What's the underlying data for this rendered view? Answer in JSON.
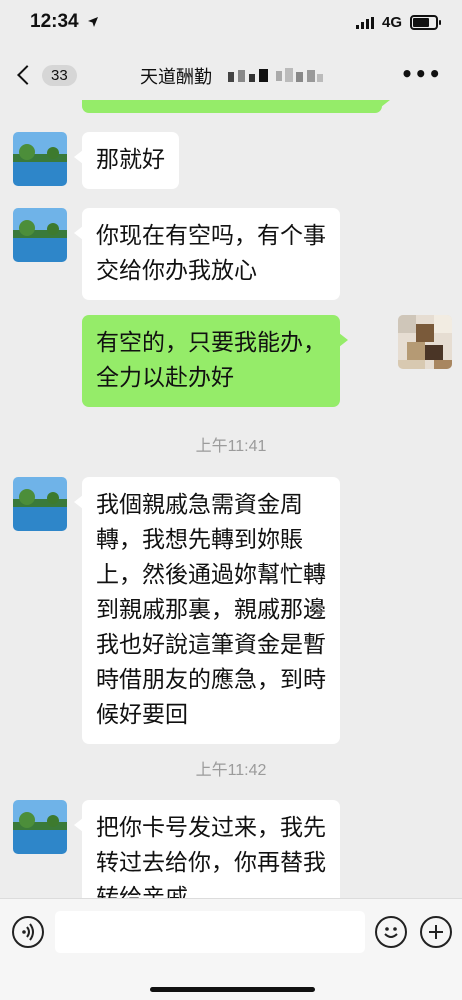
{
  "status": {
    "time": "12:34",
    "network": "4G"
  },
  "nav": {
    "unread_count": "33",
    "title": "天道酬勤"
  },
  "messages": [
    {
      "direction": "incoming",
      "text": "那就好"
    },
    {
      "direction": "incoming",
      "text": "你现在有空吗，有个事\n交给你办我放心"
    },
    {
      "direction": "outgoing",
      "text": "有空的，只要我能办，\n全力以赴办好"
    },
    {
      "direction": "incoming",
      "text": "我個親戚急需資金周\n轉，我想先轉到妳賬\n上，然後通過妳幫忙轉\n到親戚那裏，親戚那邊\n我也好說這筆資金是暫\n時借朋友的應急，到時\n候好要回"
    },
    {
      "direction": "incoming",
      "text": "把你卡号发过来，我先\n转过去给你，你再替我\n转给亲戚"
    }
  ],
  "timestamps": [
    "上午11:41",
    "上午11:42"
  ],
  "icons": {
    "location": "location-arrow-icon",
    "signal": "cellular-signal-icon",
    "battery": "battery-icon",
    "back": "chevron-left-icon",
    "more": "more-dots-icon",
    "voice": "voice-icon",
    "emoji": "emoji-icon",
    "plus": "plus-icon"
  },
  "colors": {
    "background": "#ededed",
    "incoming_bubble": "#ffffff",
    "outgoing_bubble": "#95ec69",
    "timestamp": "#9b9b9b"
  }
}
